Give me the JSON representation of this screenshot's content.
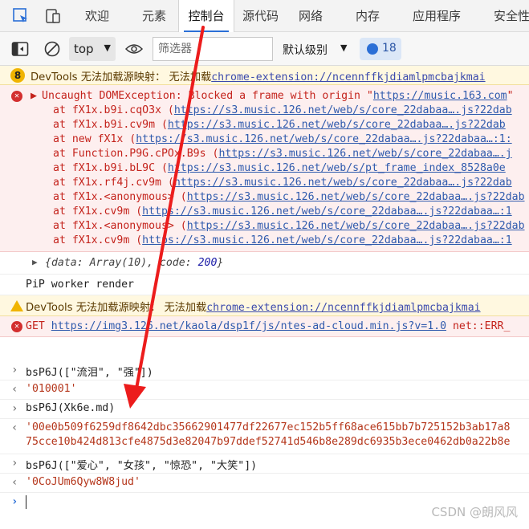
{
  "tabs": [
    "欢迎",
    "元素",
    "控制台",
    "源代码",
    "网络",
    "内存",
    "应用程序",
    "安全性"
  ],
  "toolbar": {
    "context": "top",
    "filter_placeholder": "筛选器",
    "level": "默认级别",
    "issues_count": "18"
  },
  "console": {
    "warn1": {
      "badge": "8",
      "text": "DevTools 无法加载源映射： 无法加载",
      "link": "chrome-extension://ncennffkjdiamlpmcbajkmai"
    },
    "error1": {
      "head_prefix": "Uncaught DOMException: Blocked a frame with origin \"",
      "head_link": "https://music.163.com",
      "head_suffix": "\"",
      "stack": [
        {
          "at": "at fX1x.b9i.cqO3x (",
          "link": "https://s3.music.126.net/web/s/core_22dabaa….js?22dab"
        },
        {
          "at": "at fX1x.b9i.cv9m (",
          "link": "https://s3.music.126.net/web/s/core_22dabaa….js?22dab"
        },
        {
          "at": "at new fX1x (",
          "link": "https://s3.music.126.net/web/s/core_22dabaa….js?22dabaa…:1:"
        },
        {
          "at": "at Function.P9G.cPOx.B9s (",
          "link": "https://s3.music.126.net/web/s/core_22dabaa….j"
        },
        {
          "at": "at fX1x.b9i.bL9C (",
          "link": "https://s3.music.126.net/web/s/pt_frame_index_8528a0e"
        },
        {
          "at": "at fX1x.rf4j.cv9m (",
          "link": "https://s3.music.126.net/web/s/core_22dabaa….js?22dab"
        },
        {
          "at": "at fX1x.<anonymous> (",
          "link": "https://s3.music.126.net/web/s/core_22dabaa….js?22dab"
        },
        {
          "at": "at fX1x.cv9m (",
          "link": "https://s3.music.126.net/web/s/core_22dabaa….js?22dabaa…:1"
        },
        {
          "at": "at fX1x.<anonymous> (",
          "link": "https://s3.music.126.net/web/s/core_22dabaa….js?22dab"
        },
        {
          "at": "at fX1x.cv9m (",
          "link": "https://s3.music.126.net/web/s/core_22dabaa….js?22dabaa…:1"
        }
      ]
    },
    "obj_row": {
      "open": "{data: Array(10), code: ",
      "code": "200",
      "close": "}"
    },
    "pip": "PiP worker render",
    "warn2": {
      "text": "DevTools 无法加载源映射： 无法加载",
      "link": "chrome-extension://ncennffkjdiamlpmcbajkmai"
    },
    "error2": {
      "method": "GET ",
      "link": "https://img3.126.net/kaola/dsp1f/js/ntes-ad-cloud.min.js?v=1.0",
      "status": " net::ERR_"
    },
    "cmd1": "bsP6J([\"流泪\", \"强\"])",
    "res1": "'010001'",
    "cmd2": "bsP6J(Xk6e.md)",
    "res2_line1": "'00e0b509f6259df8642dbc35662901477df22677ec152b5ff68ace615bb7b725152b3ab17a8",
    "res2_line2": "75cce10b424d813cfe4875d3e82047b97ddef52741d546b8e289dc6935b3ece0462db0a22b8e",
    "cmd3": "bsP6J([\"爱心\", \"女孩\", \"惊恐\", \"大笑\"])",
    "res3": "'0CoJUm6Qyw8W8jud'"
  },
  "watermark": "CSDN @朗风风"
}
